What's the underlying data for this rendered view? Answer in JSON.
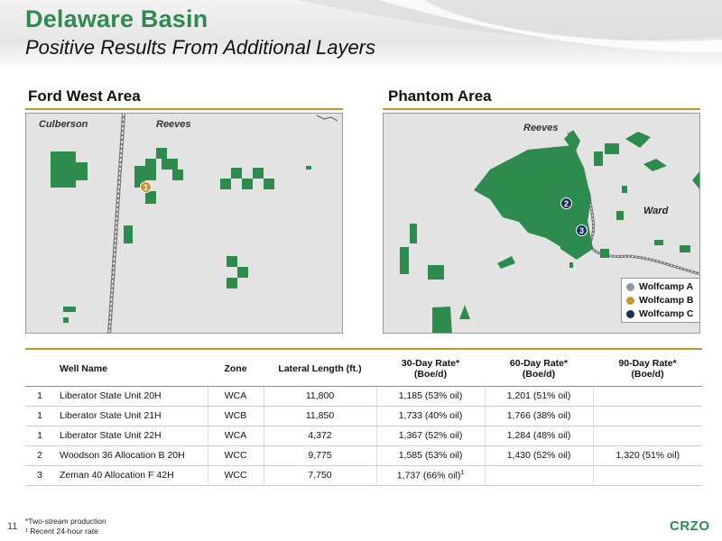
{
  "header": {
    "title": "Delaware Basin",
    "subtitle": "Positive Results From Additional Layers"
  },
  "left_map": {
    "section_title": "Ford West Area",
    "county_labels": [
      "Culberson",
      "Reeves"
    ],
    "markers": [
      "1"
    ]
  },
  "right_map": {
    "section_title": "Phantom Area",
    "county_labels": [
      "Reeves",
      "Ward"
    ],
    "markers": [
      "2",
      "3"
    ],
    "legend": [
      {
        "label": "Wolfcamp A",
        "color": "#8a9aa8"
      },
      {
        "label": "Wolfcamp B",
        "color": "#c8962f"
      },
      {
        "label": "Wolfcamp C",
        "color": "#1b2f5a"
      }
    ]
  },
  "colors": {
    "brand_green": "#2e8b4e",
    "acreage_green": "#2e8b4e",
    "accent_gold": "#c8962f"
  },
  "table": {
    "headers": {
      "well_name": "Well Name",
      "zone": "Zone",
      "lateral_length": "Lateral Length (ft.)",
      "rate30_line1": "30-Day Rate*",
      "rate30_line2": "(Boe/d)",
      "rate60_line1": "60-Day Rate*",
      "rate60_line2": "(Boe/d)",
      "rate90_line1": "90-Day Rate*",
      "rate90_line2": "(Boe/d)"
    },
    "rows": [
      {
        "num": "1",
        "well": "Liberator State Unit 20H",
        "zone": "WCA",
        "length": "11,800",
        "rate30": "1,185 (53% oil)",
        "rate30_sup": "",
        "rate60": "1,201 (51% oil)",
        "rate90": ""
      },
      {
        "num": "1",
        "well": "Liberator State Unit 21H",
        "zone": "WCB",
        "length": "11,850",
        "rate30": "1,733 (40% oil)",
        "rate30_sup": "",
        "rate60": "1,766 (38% oil)",
        "rate90": ""
      },
      {
        "num": "1",
        "well": "Liberator State Unit 22H",
        "zone": "WCA",
        "length": "4,372",
        "rate30": "1,367 (52% oil)",
        "rate30_sup": "",
        "rate60": "1,284 (48% oil)",
        "rate90": ""
      },
      {
        "num": "2",
        "well": "Woodson 36 Allocation B 20H",
        "zone": "WCC",
        "length": "9,775",
        "rate30": "1,585 (53% oil)",
        "rate30_sup": "",
        "rate60": "1,430 (52% oil)",
        "rate90": "1,320 (51% oil)"
      },
      {
        "num": "3",
        "well": "Zeman 40 Allocation F 42H",
        "zone": "WCC",
        "length": "7,750",
        "rate30": "1,737 (66% oil)",
        "rate30_sup": "1",
        "rate60": "",
        "rate90": ""
      }
    ]
  },
  "footnotes": {
    "note1": "*Two-stream production",
    "note2": "¹ Recent 24-hour rate"
  },
  "footer": {
    "page_number": "11",
    "logo": "CRZO"
  }
}
